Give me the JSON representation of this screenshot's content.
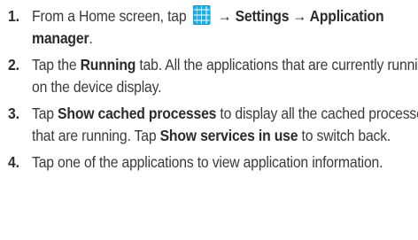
{
  "steps": [
    {
      "number": "1.",
      "segments": [
        {
          "text": "From a Home screen, tap ",
          "bold": false
        },
        {
          "icon": "apps-grid-icon"
        },
        {
          "text": " → Settings → Application manager",
          "bold": true
        },
        {
          "text": ".",
          "bold": false
        }
      ]
    },
    {
      "number": "2.",
      "segments": [
        {
          "text": "Tap the ",
          "bold": false
        },
        {
          "text": "Running",
          "bold": true
        },
        {
          "text": " tab. All the applications that are currently running on the device display.",
          "bold": false
        }
      ]
    },
    {
      "number": "3.",
      "segments": [
        {
          "text": "Tap ",
          "bold": false
        },
        {
          "text": "Show cached processes",
          "bold": true
        },
        {
          "text": " to display all the cached processes that are running. Tap ",
          "bold": false
        },
        {
          "text": "Show services in use",
          "bold": true
        },
        {
          "text": " to switch back.",
          "bold": false
        }
      ]
    },
    {
      "number": "4.",
      "segments": [
        {
          "text": "Tap one of the applications to view application information.",
          "bold": false
        }
      ]
    }
  ],
  "colors": {
    "text": "#3a3a3a",
    "icon_accent": "#1faee3"
  }
}
